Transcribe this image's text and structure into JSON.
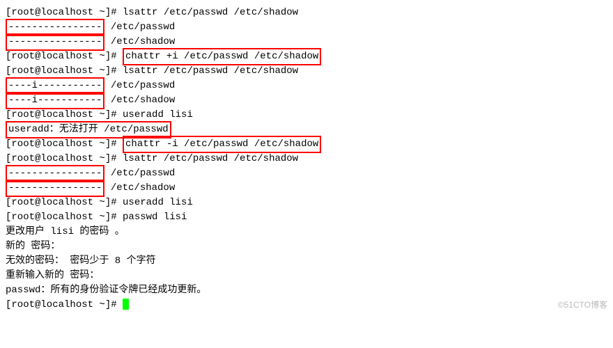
{
  "prompt": "[root@localhost ~]# ",
  "cmds": {
    "lsattr1": "lsattr /etc/passwd /etc/shadow",
    "chattr_plus": "chattr +i /etc/passwd /etc/shadow",
    "lsattr2": "lsattr /etc/passwd /etc/shadow",
    "useradd1": "useradd lisi",
    "chattr_minus": "chattr -i /etc/passwd /etc/shadow",
    "lsattr3": "lsattr /etc/passwd /etc/shadow",
    "useradd2": "useradd lisi",
    "passwd": "passwd lisi"
  },
  "out": {
    "attrs_none": "----------------",
    "attrs_i": "----i-----------",
    "sp_passwd": " /etc/passwd",
    "sp_shadow": " /etc/shadow",
    "useradd_err": "useradd：无法打开 /etc/passwd",
    "pw_change": "更改用户 lisi 的密码 。",
    "pw_new": "新的 密码：",
    "pw_invalid": "无效的密码： 密码少于 8 个字符",
    "pw_retype": "重新输入新的 密码：",
    "pw_success": "passwd：所有的身份验证令牌已经成功更新。"
  },
  "watermark": "©51CTO博客"
}
